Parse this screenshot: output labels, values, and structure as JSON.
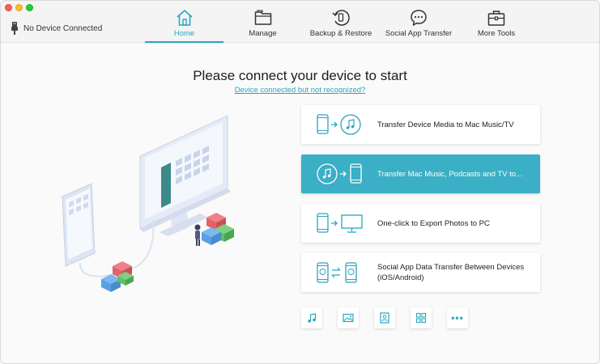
{
  "device_status": {
    "label": "No Device Connected",
    "icon": "usb-icon"
  },
  "tabs": [
    {
      "label": "Home",
      "icon": "home-icon",
      "active": true
    },
    {
      "label": "Manage",
      "icon": "folder-icon",
      "active": false
    },
    {
      "label": "Backup & Restore",
      "icon": "backup-restore-icon",
      "active": false
    },
    {
      "label": "Social App Transfer",
      "icon": "chat-bubble-icon",
      "active": false
    },
    {
      "label": "More Tools",
      "icon": "toolbox-icon",
      "active": false
    }
  ],
  "main": {
    "headline": "Please connect your device to start",
    "help_link": "Device connected but not recognized?"
  },
  "actions": [
    {
      "label": "Transfer Device Media to Mac Music/TV",
      "icon": "device-to-music-icon",
      "active": false
    },
    {
      "label": "Transfer Mac Music, Podcasts and TV to...",
      "icon": "music-to-device-icon",
      "active": true
    },
    {
      "label": "One-click to Export Photos to PC",
      "icon": "device-to-monitor-icon",
      "active": false
    },
    {
      "label": "Social App Data Transfer Between Devices (iOS/Android)",
      "icon": "phone-swap-icon",
      "active": false
    }
  ],
  "quick_tools": [
    {
      "icon": "music-note-icon"
    },
    {
      "icon": "photo-icon"
    },
    {
      "icon": "contacts-icon"
    },
    {
      "icon": "apps-grid-icon"
    },
    {
      "icon": "more-icon",
      "label": "•••"
    }
  ],
  "colors": {
    "accent": "#2aa5bf",
    "active_card": "#3aafc5"
  }
}
